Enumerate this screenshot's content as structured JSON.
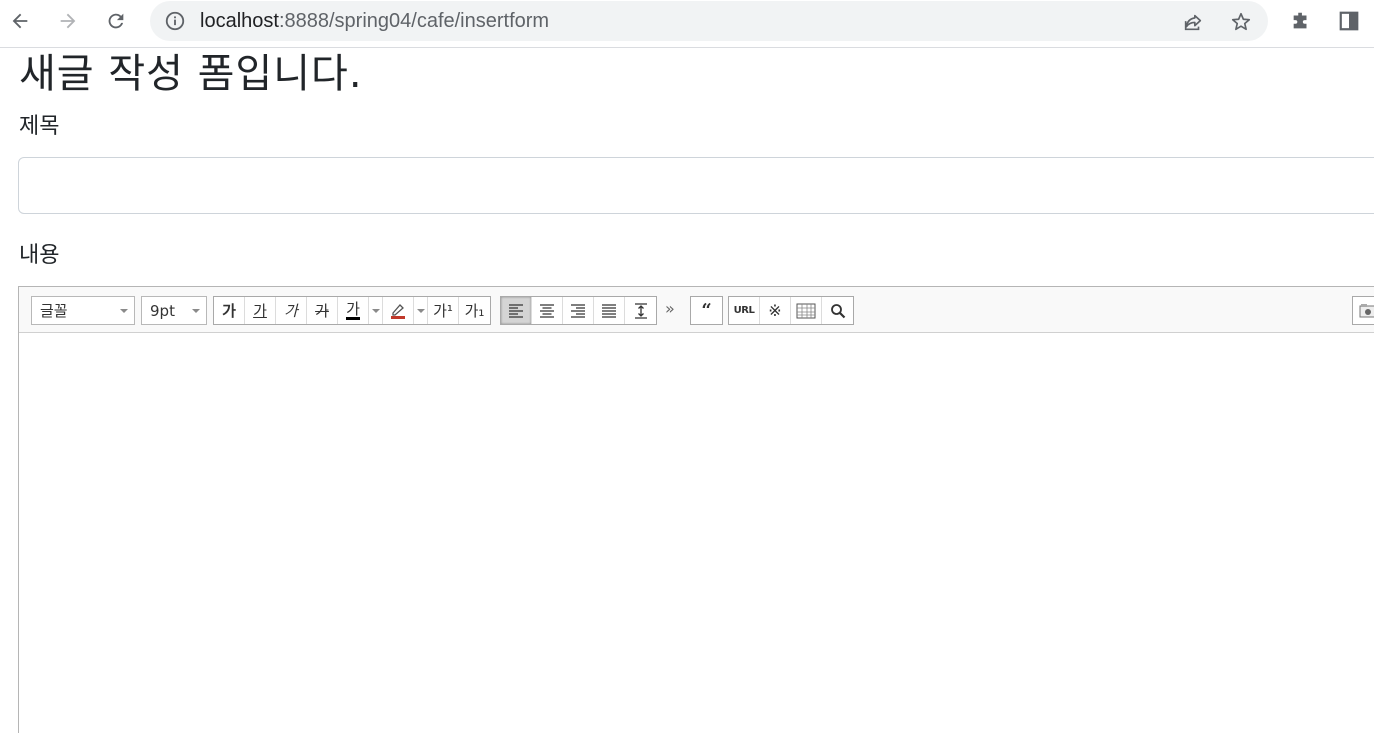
{
  "browser": {
    "url_host": "localhost",
    "url_rest": ":8888/spring04/cafe/insertform",
    "icons": [
      "back-arrow-icon",
      "forward-arrow-icon",
      "reload-icon",
      "info-icon",
      "share-icon",
      "star-icon",
      "extensions-icon",
      "side-panel-icon"
    ]
  },
  "page": {
    "title": "새글 작성 폼입니다.",
    "subject_label": "제목",
    "subject_value": "",
    "content_label": "내용"
  },
  "editor": {
    "font_select": "글꼴",
    "size_select": "9pt",
    "format_buttons": [
      "가",
      "가",
      "가",
      "가",
      "가"
    ],
    "superscript": "가¹",
    "subscript": "가₁",
    "more": "»",
    "url_button": "URL",
    "special_char": "※"
  }
}
